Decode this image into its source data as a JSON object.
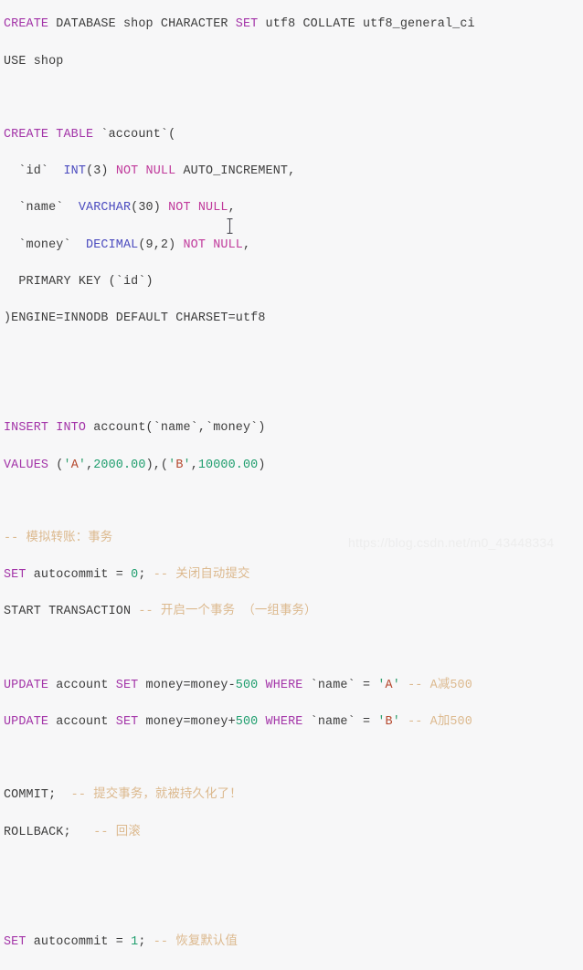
{
  "editor": {
    "background_color": "#f7f7f8",
    "language": "sql",
    "palette": {
      "keyword": "#a334a8",
      "plain": "#3c3c3c",
      "datatype": "#4b4bbf",
      "constraint": "#c0399b",
      "number": "#1f9e6e",
      "quote": "#2f9e6e",
      "string": "#b4452a",
      "backtick": "#9a9a9a",
      "comment": "#dcb98e"
    }
  },
  "code": {
    "l1_create": "CREATE",
    "l1_rest": " DATABASE shop CHARACTER ",
    "l1_set": "SET",
    "l1_tail": " utf8 COLLATE utf8_general_ci",
    "l2": "USE shop",
    "l4_kw": "CREATE TABLE",
    "l4_rest": " `account`(",
    "l5_ident": "  `id`  ",
    "l5_type": "INT",
    "l5_size": "(3) ",
    "l5_constraint": "NOT NULL",
    "l5_tail": " AUTO_INCREMENT,",
    "l6_ident": "  `name`  ",
    "l6_type": "VARCHAR",
    "l6_size": "(30) ",
    "l6_constraint": "NOT NULL",
    "l6_tail": ",",
    "l7_ident": "  `money`  ",
    "l7_type": "DECIMAL",
    "l7_size": "(9,2) ",
    "l7_constraint": "NOT NULL",
    "l7_tail": ",",
    "l8": "  PRIMARY KEY (`id`)",
    "l9": ")ENGINE=INNODB DEFAULT CHARSET=utf8",
    "l12_kw": "INSERT INTO",
    "l12_rest": " account(`name`,`money`)",
    "l13_kw": "VALUES",
    "l13_open": " (",
    "l13_q1": "'",
    "l13_a": "A",
    "l13_q2": "'",
    "l13_comma1": ",",
    "l13_n1": "2000.00",
    "l13_mid": "),(",
    "l13_q3": "'",
    "l13_b": "B",
    "l13_q4": "'",
    "l13_comma2": ",",
    "l13_n2": "10000.00",
    "l13_close": ")",
    "l15_comment": "-- 模拟转账：事务",
    "l16_set": "SET",
    "l16_var": " autocommit = ",
    "l16_val": "0",
    "l16_semi": "; ",
    "l16_comment": "-- 关闭自动提交",
    "l17_kw": "START TRANSACTION ",
    "l17_comment": "-- 开启一个事务 （一组事务）",
    "l19_update": "UPDATE",
    "l19_tbl": " account ",
    "l19_set": "SET",
    "l19_expr": " money=money-",
    "l19_num": "500",
    "l19_sp": " ",
    "l19_where": "WHERE",
    "l19_col": " `name` = ",
    "l19_q1": "'",
    "l19_val": "A",
    "l19_q2": "' ",
    "l19_comment": "-- A减500",
    "l20_update": "UPDATE",
    "l20_tbl": " account ",
    "l20_set": "SET",
    "l20_expr": " money=money+",
    "l20_num": "500",
    "l20_sp": " ",
    "l20_where": "WHERE",
    "l20_col": " `name` = ",
    "l20_q1": "'",
    "l20_val": "B",
    "l20_q2": "' ",
    "l20_comment": "-- A加500",
    "l22_kw": "COMMIT;  ",
    "l22_comment": "-- 提交事务，就被持久化了！",
    "l23_kw": "ROLLBACK;   ",
    "l23_comment": "-- 回滚",
    "l25_set": "SET",
    "l25_var": " autocommit = ",
    "l25_val": "1",
    "l25_semi": "; ",
    "l25_comment": "-- 恢复默认值"
  },
  "overlay": {
    "watermark": "https://blog.csdn.net/m0_43448334",
    "mouse_cursor": "i-beam-cursor"
  }
}
